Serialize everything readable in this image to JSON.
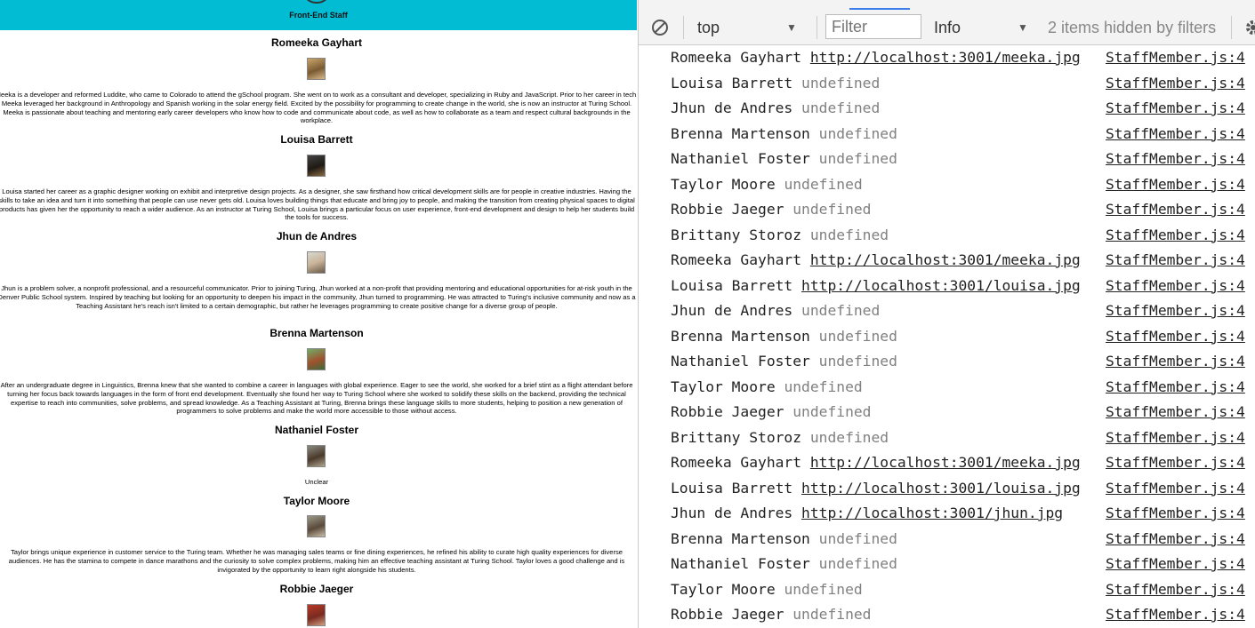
{
  "page": {
    "banner_title": "Front-End Staff",
    "staff": [
      {
        "name": "Romeeka Gayhart",
        "bio": "Meeka is a developer and reformed Luddite, who came to Colorado to attend the gSchool program. She went on to work as a consultant and developer, specializing in Ruby and JavaScript. Prior to her career in tech, Meeka leveraged her background in Anthropology and Spanish working in the solar energy field. Excited by the possibility for programming to create change in the world, she is now an instructor at Turing School. Meeka is passionate about teaching and mentoring early career developers who know how to code and communicate about code, as well as how to collaborate as a team and respect cultural backgrounds in the workplace."
      },
      {
        "name": "Louisa Barrett",
        "bio": "Louisa started her career as a graphic designer working on exhibit and interpretive design projects. As a designer, she saw firsthand how critical development skills are for people in creative industries. Having the skills to take an idea and turn it into something that people can use never gets old. Louisa loves building things that educate and bring joy to people, and making the transition from creating physical spaces to digital products has given her the opportunity to reach a wider audience. As an instructor at Turing School, Louisa brings a particular focus on user experience, front-end development and design to help her students build the tools for success."
      },
      {
        "name": "Jhun de Andres",
        "bio": "Jhun is a problem solver, a nonprofit professional, and a resourceful communicator. Prior to joining Turing, Jhun worked at a non-profit that providing mentoring and educational opportunities for at-risk youth in the Denver Public School system. Inspired by teaching but looking for an opportunity to deepen his impact in the community, Jhun turned to programming. He was attracted to Turing's inclusive community and now as a Teaching Assistant he's reach isn't limited to a certain demographic, but rather he leverages programming to create positive change for a diverse group of people."
      },
      {
        "name": "Brenna Martenson",
        "bio": "After an undergraduate degree in Linguistics, Brenna knew that she wanted to combine a career in languages with global experience. Eager to see the world, she worked for a brief stint as a flight attendant before turning her focus back towards languages in the form of front end development. Eventually she found her way to Turing School where she worked to solidify these skills on the backend, providing the technical expertise to reach into communities, solve problems, and spread knowledge. As a Teaching Assistant at Turing, Brenna brings these language skills to more students, helping to position a new generation of programmers to solve problems and make the world more accessible to those without access."
      },
      {
        "name": "Nathaniel Foster",
        "bio": "Unclear"
      },
      {
        "name": "Taylor Moore",
        "bio": "Taylor brings unique experience in customer service to the Turing team. Whether he was managing sales teams or fine dining experiences, he refined his ability to curate high quality experiences for diverse audiences. He has the stamina to compete in dance marathons and the curiosity to solve complex problems, making him an effective teaching assistant at Turing School. Taylor loves a good challenge and is invigorated by the opportunity to learn right alongside his students."
      },
      {
        "name": "Robbie Jaeger",
        "bio": ""
      }
    ]
  },
  "console": {
    "context": "top",
    "filter_placeholder": "Filter",
    "level": "Info",
    "hidden_count": "2 items hidden by filters",
    "logs": [
      {
        "name": "Romeeka Gayhart",
        "value": "http://localhost:3001/meeka.jpg",
        "is_url": true,
        "source": "StaffMember.js:4"
      },
      {
        "name": "Louisa Barrett",
        "value": "undefined",
        "is_url": false,
        "source": "StaffMember.js:4"
      },
      {
        "name": "Jhun de Andres",
        "value": "undefined",
        "is_url": false,
        "source": "StaffMember.js:4"
      },
      {
        "name": "Brenna Martenson",
        "value": "undefined",
        "is_url": false,
        "source": "StaffMember.js:4"
      },
      {
        "name": "Nathaniel Foster",
        "value": "undefined",
        "is_url": false,
        "source": "StaffMember.js:4"
      },
      {
        "name": "Taylor Moore",
        "value": "undefined",
        "is_url": false,
        "source": "StaffMember.js:4"
      },
      {
        "name": "Robbie Jaeger",
        "value": "undefined",
        "is_url": false,
        "source": "StaffMember.js:4"
      },
      {
        "name": "Brittany Storoz",
        "value": "undefined",
        "is_url": false,
        "source": "StaffMember.js:4"
      },
      {
        "name": "Romeeka Gayhart",
        "value": "http://localhost:3001/meeka.jpg",
        "is_url": true,
        "source": "StaffMember.js:4"
      },
      {
        "name": "Louisa Barrett",
        "value": "http://localhost:3001/louisa.jpg",
        "is_url": true,
        "source": "StaffMember.js:4"
      },
      {
        "name": "Jhun de Andres",
        "value": "undefined",
        "is_url": false,
        "source": "StaffMember.js:4"
      },
      {
        "name": "Brenna Martenson",
        "value": "undefined",
        "is_url": false,
        "source": "StaffMember.js:4"
      },
      {
        "name": "Nathaniel Foster",
        "value": "undefined",
        "is_url": false,
        "source": "StaffMember.js:4"
      },
      {
        "name": "Taylor Moore",
        "value": "undefined",
        "is_url": false,
        "source": "StaffMember.js:4"
      },
      {
        "name": "Robbie Jaeger",
        "value": "undefined",
        "is_url": false,
        "source": "StaffMember.js:4"
      },
      {
        "name": "Brittany Storoz",
        "value": "undefined",
        "is_url": false,
        "source": "StaffMember.js:4"
      },
      {
        "name": "Romeeka Gayhart",
        "value": "http://localhost:3001/meeka.jpg",
        "is_url": true,
        "source": "StaffMember.js:4"
      },
      {
        "name": "Louisa Barrett",
        "value": "http://localhost:3001/louisa.jpg",
        "is_url": true,
        "source": "StaffMember.js:4"
      },
      {
        "name": "Jhun de Andres",
        "value": "http://localhost:3001/jhun.jpg",
        "is_url": true,
        "source": "StaffMember.js:4"
      },
      {
        "name": "Brenna Martenson",
        "value": "undefined",
        "is_url": false,
        "source": "StaffMember.js:4"
      },
      {
        "name": "Nathaniel Foster",
        "value": "undefined",
        "is_url": false,
        "source": "StaffMember.js:4"
      },
      {
        "name": "Taylor Moore",
        "value": "undefined",
        "is_url": false,
        "source": "StaffMember.js:4"
      },
      {
        "name": "Robbie Jaeger",
        "value": "undefined",
        "is_url": false,
        "source": "StaffMember.js:4"
      }
    ]
  },
  "colors": {
    "banner": "#02bcd4",
    "undefined_text": "#808080",
    "active_tab": "#3b7ded"
  }
}
